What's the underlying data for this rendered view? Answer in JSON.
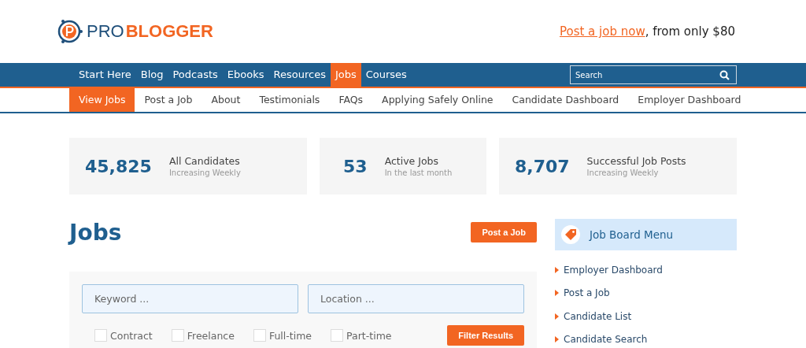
{
  "logo": {
    "part_1": "PRO",
    "part_2": "BLOGGER"
  },
  "promo": {
    "link": "Post a job now",
    "text": ", from only $80"
  },
  "main_nav": [
    {
      "label": "Start Here",
      "selected": false
    },
    {
      "label": "Blog",
      "selected": false
    },
    {
      "label": "Podcasts",
      "selected": false
    },
    {
      "label": "Ebooks",
      "selected": false
    },
    {
      "label": "Resources",
      "selected": false
    },
    {
      "label": "Jobs",
      "selected": true
    },
    {
      "label": "Courses",
      "selected": false
    }
  ],
  "search": {
    "placeholder": "Search"
  },
  "sub_nav": [
    {
      "label": "View Jobs",
      "selected": true
    },
    {
      "label": "Post a Job",
      "selected": false
    },
    {
      "label": "About",
      "selected": false
    },
    {
      "label": "Testimonials",
      "selected": false
    },
    {
      "label": "FAQs",
      "selected": false
    },
    {
      "label": "Applying Safely Online",
      "selected": false
    },
    {
      "label": "Candidate Dashboard",
      "selected": false
    },
    {
      "label": "Employer Dashboard",
      "selected": false
    }
  ],
  "stats": [
    {
      "number": "45,825",
      "label": "All Candidates",
      "caption": "Increasing Weekly"
    },
    {
      "number": "53",
      "label": "Active Jobs",
      "caption": "In the last month"
    },
    {
      "number": "8,707",
      "label": "Successful Job Posts",
      "caption": "Increasing Weekly"
    }
  ],
  "heading": "Jobs",
  "post_button": "Post a Job",
  "filter": {
    "keyword_placeholder": "Keyword ...",
    "location_placeholder": "Location ...",
    "types": [
      {
        "label": "Contract",
        "checked": false
      },
      {
        "label": "Freelance",
        "checked": false
      },
      {
        "label": "Full-time",
        "checked": false
      },
      {
        "label": "Part-time",
        "checked": false
      }
    ],
    "button": "Filter Results"
  },
  "sidebar": {
    "title": "Job Board Menu",
    "items": [
      "Employer Dashboard",
      "Post a Job",
      "Candidate List",
      "Candidate Search"
    ]
  }
}
